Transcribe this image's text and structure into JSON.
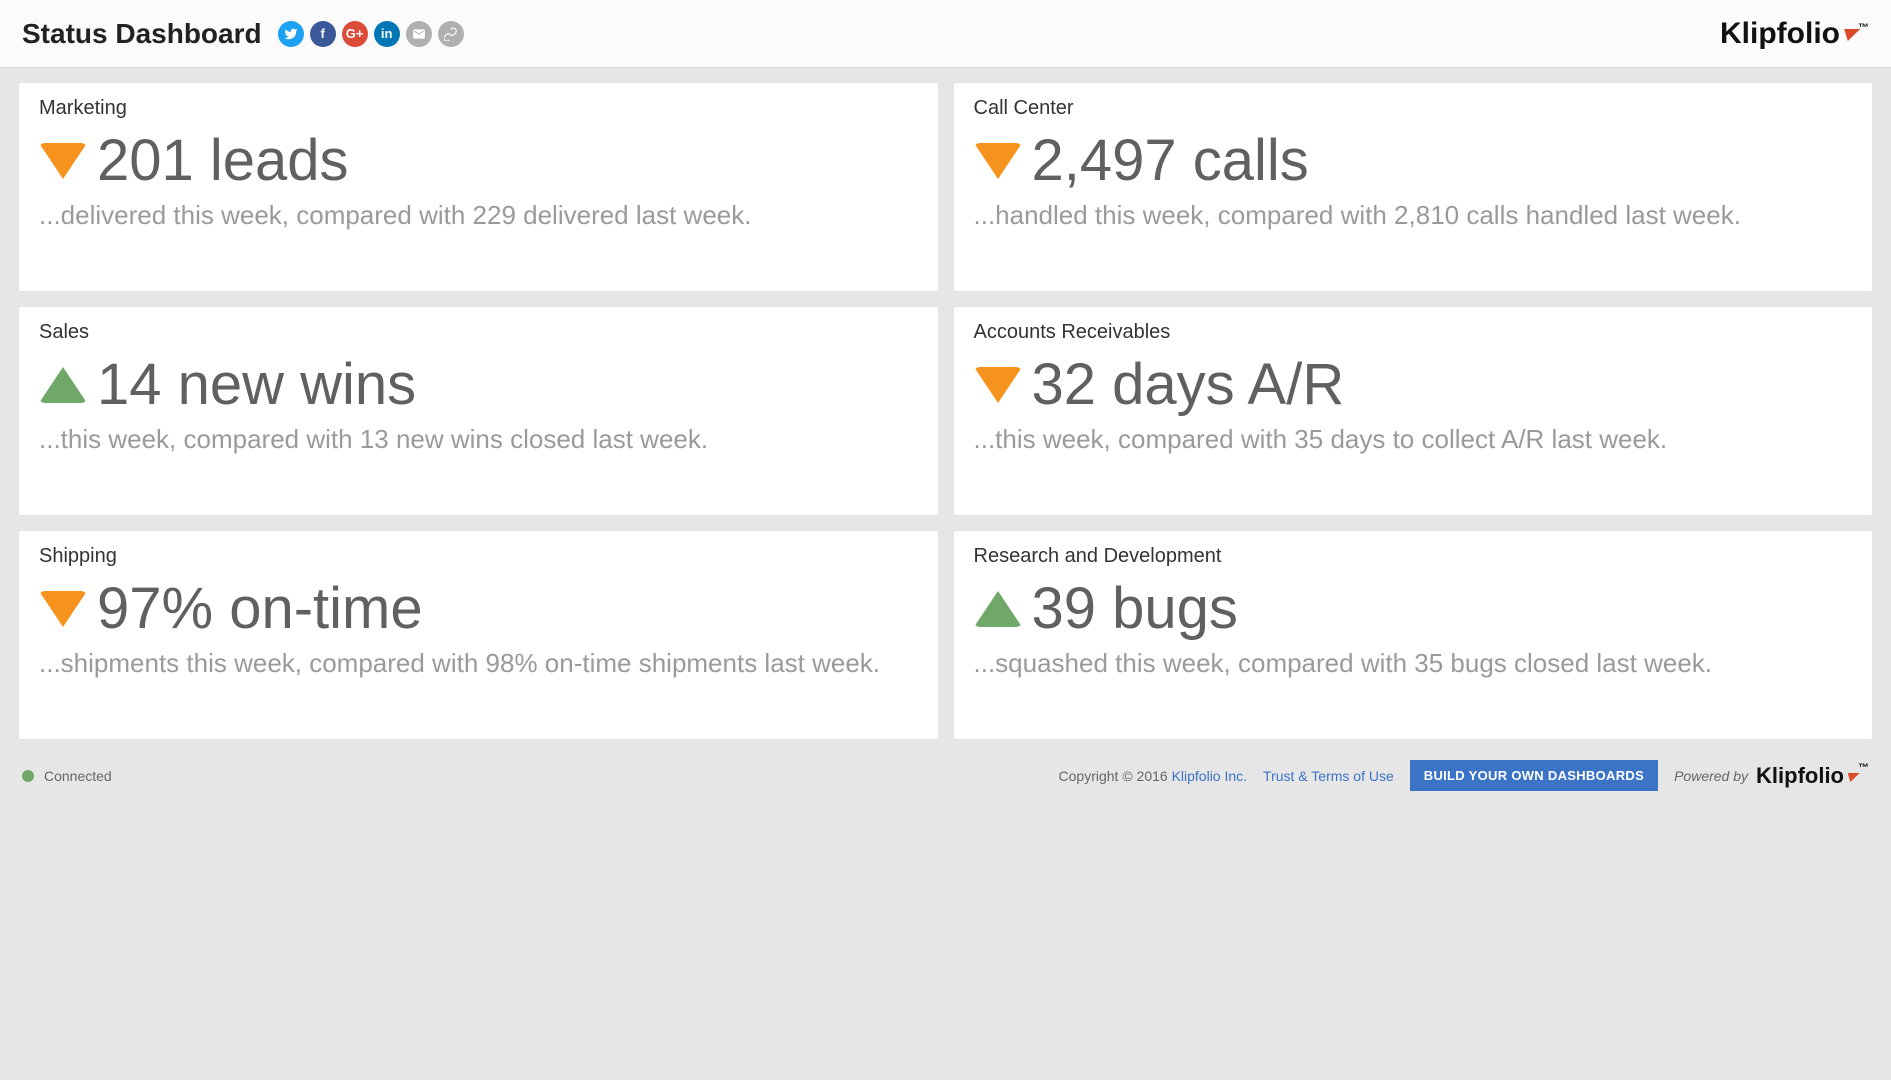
{
  "header": {
    "title": "Status Dashboard",
    "brand": "Klipfolio",
    "share": {
      "twitter": "t",
      "facebook": "f",
      "google": "G+",
      "linkedin": "in",
      "email": "✉",
      "link": "🔗"
    }
  },
  "cards": [
    {
      "title": "Marketing",
      "direction": "down",
      "metric": "201 leads",
      "sub": "...delivered this week, compared with 229 delivered last week."
    },
    {
      "title": "Call Center",
      "direction": "down",
      "metric": "2,497 calls",
      "sub": "...handled this week, compared with 2,810 calls handled last week."
    },
    {
      "title": "Sales",
      "direction": "up",
      "metric": "14 new wins",
      "sub": "...this week, compared with 13 new wins closed last week."
    },
    {
      "title": "Accounts Receivables",
      "direction": "down",
      "metric": "32 days A/R",
      "sub": "...this week, compared with 35 days to collect A/R last week."
    },
    {
      "title": "Shipping",
      "direction": "down",
      "metric": "97% on-time",
      "sub": "...shipments this week, compared with 98% on-time shipments last week."
    },
    {
      "title": "Research and Development",
      "direction": "up",
      "metric": "39 bugs",
      "sub": "...squashed this week, compared with 35 bugs closed last week."
    }
  ],
  "footer": {
    "status": "Connected",
    "copyright": "Copyright © 2016 ",
    "company_link": "Klipfolio Inc.",
    "terms": "Trust & Terms of Use",
    "cta": "BUILD YOUR OWN DASHBOARDS",
    "powered": "Powered by",
    "brand": "Klipfolio"
  }
}
